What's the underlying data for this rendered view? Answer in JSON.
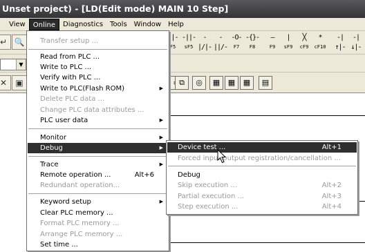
{
  "window": {
    "title": "Unset project) - [LD(Edit mode)    MAIN    10 Step]"
  },
  "menubar": {
    "items": [
      {
        "label": "View",
        "active": false
      },
      {
        "label": "Online",
        "active": true
      },
      {
        "label": "Diagnostics",
        "active": false
      },
      {
        "label": "Tools",
        "active": false
      },
      {
        "label": "Window",
        "active": false
      },
      {
        "label": "Help",
        "active": false
      }
    ]
  },
  "toolbar": {
    "symbols": [
      {
        "glyph": "-|-",
        "key": "F5"
      },
      {
        "glyph": "-||-",
        "key": "sF5"
      },
      {
        "glyph": "-|/|-",
        "key": "F6"
      },
      {
        "glyph": "-||/-",
        "key": "sF6"
      },
      {
        "glyph": "-O-",
        "key": "F7"
      },
      {
        "glyph": "-{}-",
        "key": "F8"
      },
      {
        "glyph": "—",
        "key": "F9"
      },
      {
        "glyph": "|",
        "key": "sF9"
      },
      {
        "glyph": "╳",
        "key": "cF9"
      },
      {
        "glyph": "*",
        "key": "cF10"
      },
      {
        "glyph": "-|↑|-",
        "key": "sF7"
      },
      {
        "glyph": "-|↓|-",
        "key": "sF8"
      }
    ]
  },
  "online_menu": {
    "items": [
      {
        "label": "Transfer setup ...",
        "disabled": true
      },
      {
        "label": "Read from PLC ...",
        "disabled": false
      },
      {
        "label": "Write to PLC ...",
        "disabled": false
      },
      {
        "label": "Verify with PLC ...",
        "disabled": false
      },
      {
        "label": "Write to PLC(Flash ROM)",
        "disabled": false,
        "submenu": true
      },
      {
        "label": "Delete PLC data ...",
        "disabled": true
      },
      {
        "label": "Change PLC data attributes ...",
        "disabled": true
      },
      {
        "label": "PLC user data",
        "disabled": false,
        "submenu": true
      },
      {
        "label": "Monitor",
        "disabled": false,
        "submenu": true
      },
      {
        "label": "Debug",
        "disabled": false,
        "submenu": true,
        "highlighted": true
      },
      {
        "label": "Trace",
        "disabled": false,
        "submenu": true
      },
      {
        "label": "Remote operation ...",
        "disabled": false,
        "shortcut": "Alt+6"
      },
      {
        "label": "Redundant operation...",
        "disabled": true
      },
      {
        "label": "Keyword setup",
        "disabled": false,
        "submenu": true
      },
      {
        "label": "Clear PLC memory ...",
        "disabled": false
      },
      {
        "label": "Format PLC memory ...",
        "disabled": true
      },
      {
        "label": "Arrange PLC memory ...",
        "disabled": true
      },
      {
        "label": "Set time ...",
        "disabled": false
      }
    ]
  },
  "debug_submenu": {
    "items": [
      {
        "label": "Device test ...",
        "shortcut": "Alt+1",
        "disabled": false,
        "highlighted": true
      },
      {
        "label": "Forced input output registration/cancellation ...",
        "disabled": true
      },
      {
        "label": "Debug",
        "disabled": false
      },
      {
        "label": "Skip execution ...",
        "shortcut": "Alt+2",
        "disabled": true
      },
      {
        "label": "Partial execution ...",
        "shortcut": "Alt+3",
        "disabled": true
      },
      {
        "label": "Step execution ...",
        "shortcut": "Alt+4",
        "disabled": true
      }
    ]
  },
  "colors": {
    "highlight": "#2f2f2f",
    "disabled_text": "#9a9a9a",
    "menubar_bg": "#ece9d8"
  }
}
